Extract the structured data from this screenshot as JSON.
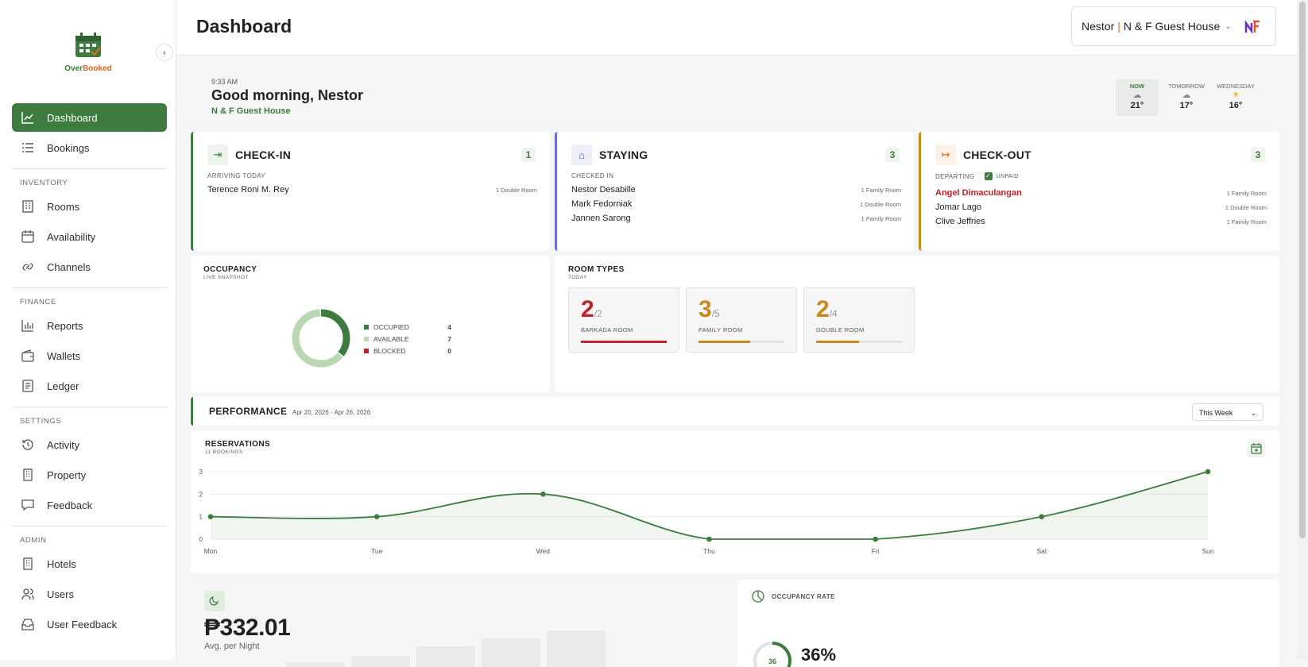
{
  "sidebar": {
    "logo": {
      "text_a": "Over",
      "text_b": "Booked"
    },
    "items_top": [
      {
        "label": "Dashboard",
        "icon": "chart-line-icon",
        "active": true
      },
      {
        "label": "Bookings",
        "icon": "list-icon"
      }
    ],
    "sections": [
      {
        "title": "INVENTORY",
        "items": [
          {
            "label": "Rooms",
            "icon": "building-icon"
          },
          {
            "label": "Availability",
            "icon": "calendar-icon"
          },
          {
            "label": "Channels",
            "icon": "link-icon"
          }
        ]
      },
      {
        "title": "FINANCE",
        "items": [
          {
            "label": "Reports",
            "icon": "bar-chart-icon"
          },
          {
            "label": "Wallets",
            "icon": "wallet-icon"
          },
          {
            "label": "Ledger",
            "icon": "ledger-icon"
          }
        ]
      },
      {
        "title": "SETTINGS",
        "items": [
          {
            "label": "Activity",
            "icon": "history-icon"
          },
          {
            "label": "Property",
            "icon": "building-icon"
          },
          {
            "label": "Feedback",
            "icon": "message-icon"
          }
        ]
      },
      {
        "title": "ADMIN",
        "items": [
          {
            "label": "Hotels",
            "icon": "building-icon"
          },
          {
            "label": "Users",
            "icon": "users-icon"
          },
          {
            "label": "User Feedback",
            "icon": "inbox-icon"
          }
        ]
      }
    ]
  },
  "header": {
    "title": "Dashboard",
    "user": "Nestor",
    "separator": "|",
    "property": "N & F Guest House"
  },
  "greeting": {
    "time": "9:33 AM",
    "message": "Good morning, Nestor",
    "property": "N & F Guest House",
    "weather": [
      {
        "label": "NOW",
        "temp": "21°",
        "icon": "cloud-icon"
      },
      {
        "label": "TOMORROW",
        "temp": "17°",
        "icon": "cloud-icon"
      },
      {
        "label": "WEDNESDAY",
        "temp": "16°",
        "icon": "sun-icon"
      }
    ]
  },
  "checkin": {
    "title": "CHECK-IN",
    "count": "1",
    "sub": "ARRIVING TODAY",
    "rows": [
      {
        "name": "Terence Roni M. Rey",
        "room": "1 Double Room"
      }
    ]
  },
  "staying": {
    "title": "STAYING",
    "count": "3",
    "sub": "CHECKED IN",
    "rows": [
      {
        "name": "Nestor Desabille",
        "room": "1 Family Room"
      },
      {
        "name": "Mark Fedorniak",
        "room": "1 Double Room"
      },
      {
        "name": "Jannen Sarong",
        "room": "1 Family Room"
      }
    ]
  },
  "checkout": {
    "title": "CHECK-OUT",
    "count": "3",
    "sub": "DEPARTING",
    "filter": "UNPAID",
    "rows": [
      {
        "name": "Angel Dimaculangan",
        "room": "1 Family Room",
        "unpaid": true
      },
      {
        "name": "Jomar Lago",
        "room": "1 Double Room"
      },
      {
        "name": "Clive Jeffries",
        "room": "1 Family Room"
      }
    ]
  },
  "occupancy": {
    "title": "OCCUPANCY",
    "sub": "LIVE SNAPSHOT",
    "legend": [
      {
        "label": "OCCUPIED",
        "value": 4,
        "color": "#3e7b3e"
      },
      {
        "label": "AVAILABLE",
        "value": 7,
        "color": "#b9d8b2"
      },
      {
        "label": "BLOCKED",
        "value": 0,
        "color": "#c0222f"
      }
    ]
  },
  "room_types": {
    "title": "ROOM TYPES",
    "sub": "TODAY",
    "items": [
      {
        "booked": "2",
        "total": "/2",
        "name": "BARKADA ROOM",
        "fraction": 1.0,
        "color": "#c0222f"
      },
      {
        "booked": "3",
        "total": "/5",
        "name": "FAMILY ROOM",
        "fraction": 0.6,
        "color": "#c9891a"
      },
      {
        "booked": "2",
        "total": "/4",
        "name": "DOUBLE ROOM",
        "fraction": 0.5,
        "color": "#c9891a"
      }
    ]
  },
  "performance": {
    "title": "PERFORMANCE",
    "range": "Apr 20, 2026 - Apr 26, 2026",
    "period": "This Week"
  },
  "reservations": {
    "title": "RESERVATIONS",
    "sub": "11 BOOKINGS"
  },
  "chart_data": {
    "type": "area",
    "categories": [
      "Mon",
      "Tue",
      "Wed",
      "Thu",
      "Fri",
      "Sat",
      "Sun"
    ],
    "values": [
      1,
      1,
      2,
      0,
      0,
      1,
      3
    ],
    "yticks": [
      0,
      1,
      2,
      3
    ],
    "ylim": [
      0,
      3
    ],
    "color": "#3e7b3e"
  },
  "avg_night": {
    "value": "₱332.01",
    "label": "Avg. per Night"
  },
  "occupancy_rate": {
    "title": "OCCUPANCY RATE",
    "value": "36%",
    "ring": "36"
  }
}
